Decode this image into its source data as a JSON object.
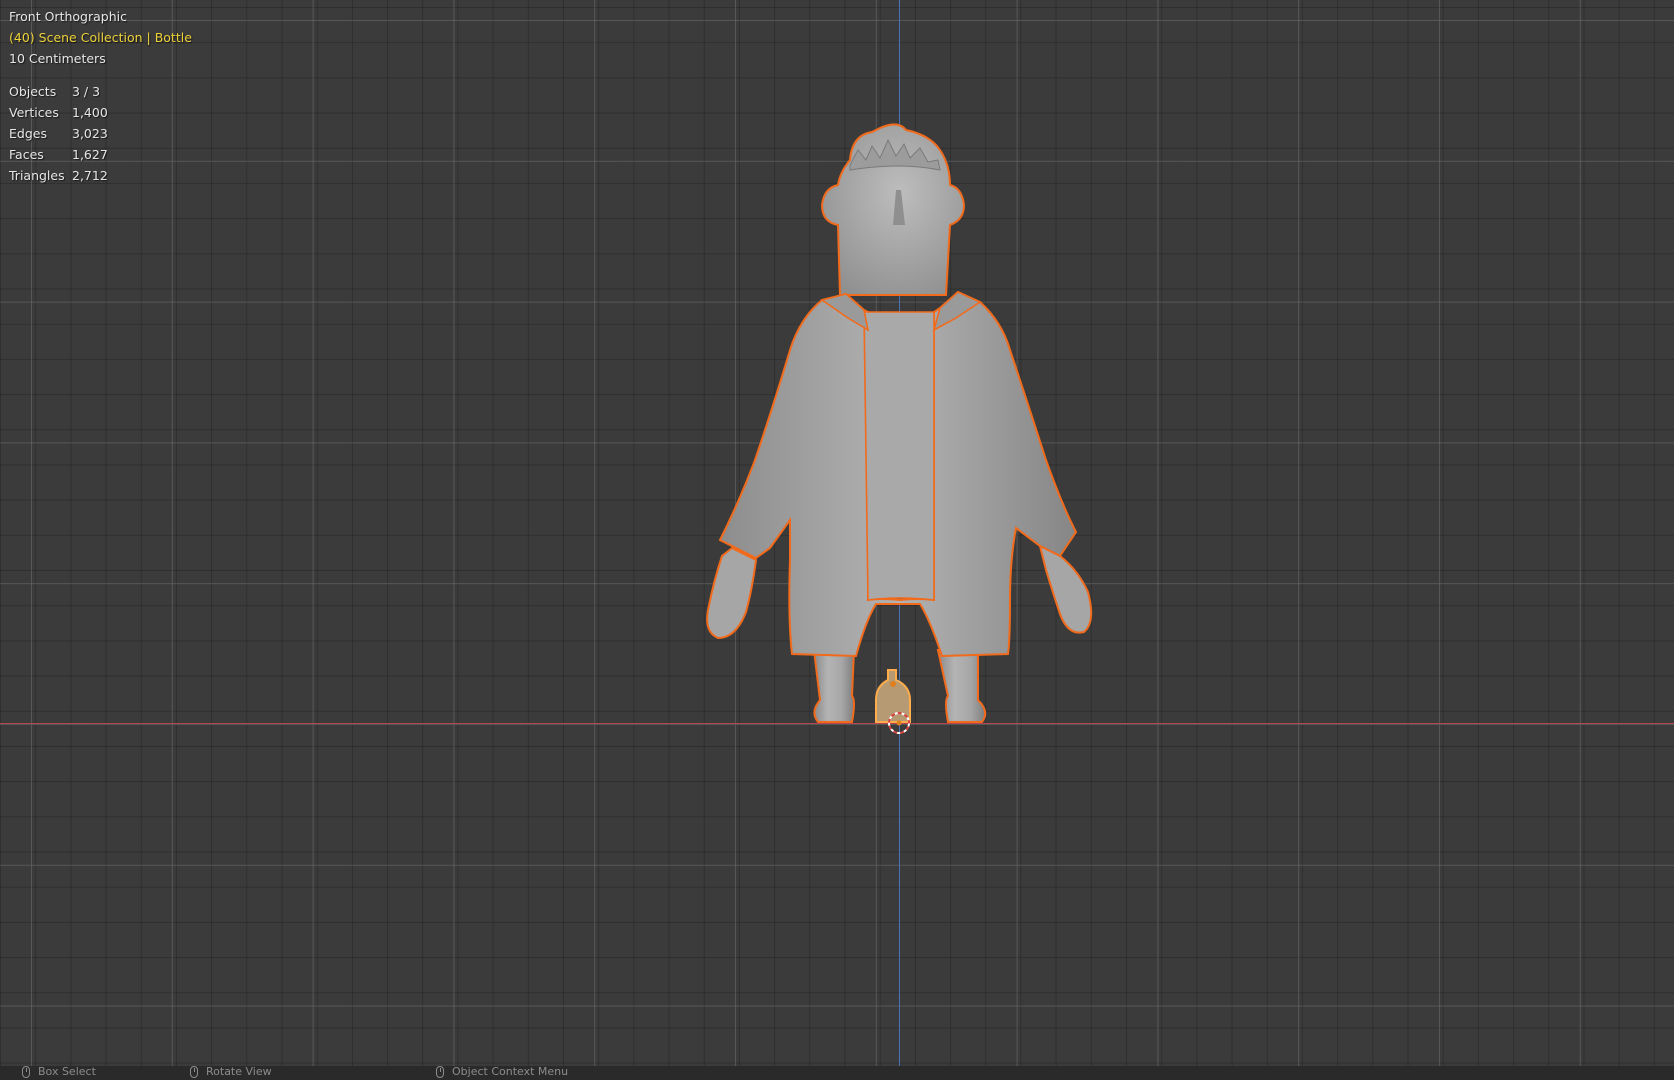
{
  "viewport": {
    "view_name": "Front Orthographic",
    "collection_info": "(40) Scene Collection | Bottle",
    "scale_info": "10 Centimeters",
    "stats": [
      {
        "label": "Objects",
        "value": "3 / 3"
      },
      {
        "label": "Vertices",
        "value": "1,400"
      },
      {
        "label": "Edges",
        "value": "3,023"
      },
      {
        "label": "Faces",
        "value": "1,627"
      },
      {
        "label": "Triangles",
        "value": "2,712"
      }
    ]
  },
  "statusbar": {
    "items": [
      {
        "label": "Box Select",
        "icon": "mouse-left-icon"
      },
      {
        "label": "Rotate View",
        "icon": "mouse-middle-icon"
      },
      {
        "label": "Object Context Menu",
        "icon": "mouse-right-icon"
      }
    ]
  },
  "colors": {
    "background": "#3b3b3b",
    "selection_outline": "#f26a1b",
    "active_outline": "#ffad4a",
    "x_axis": "#b7434f",
    "z_axis": "#4a72b2",
    "info_yellow": "#ecd13a"
  }
}
